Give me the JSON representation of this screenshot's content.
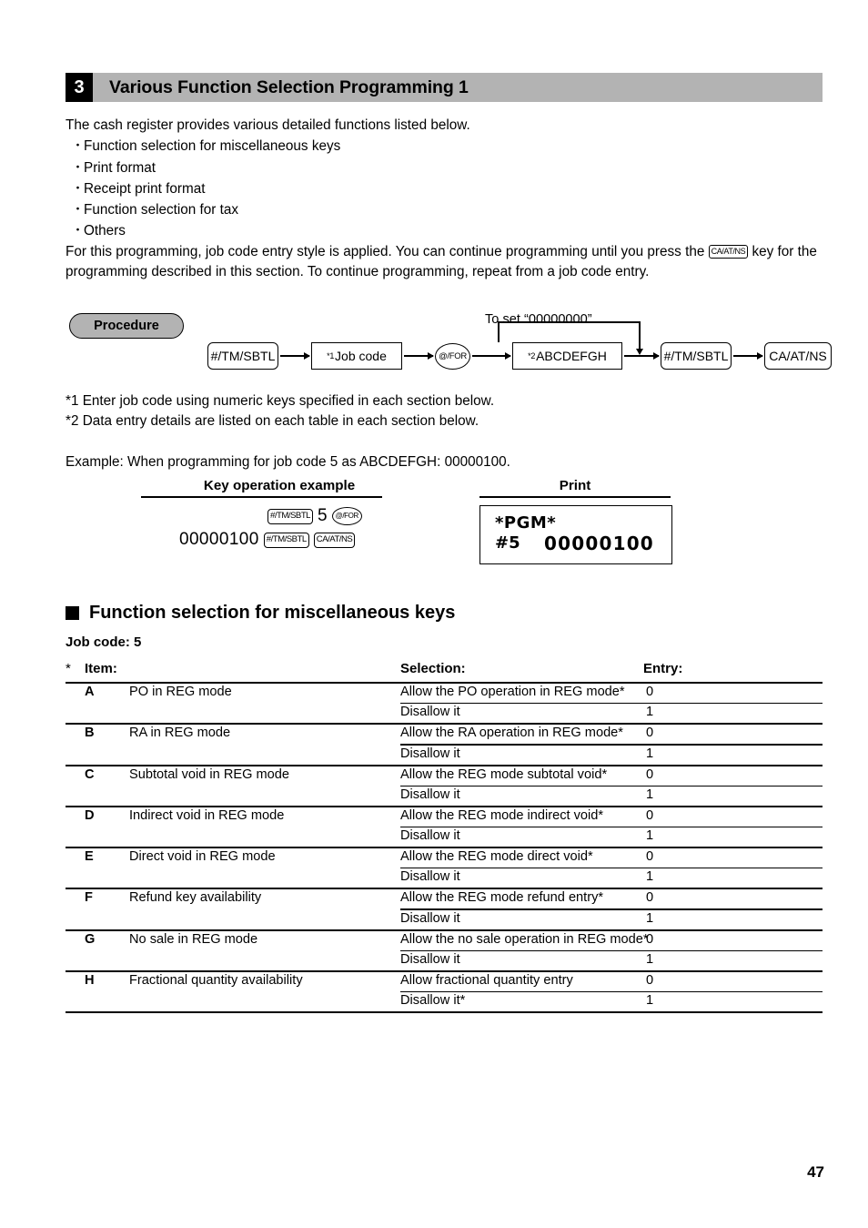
{
  "section": {
    "number": "3",
    "title": "Various Function Selection Programming 1"
  },
  "intro": {
    "lead": "The cash register provides various detailed functions listed below.",
    "bullets": [
      "Function selection for miscellaneous keys",
      "Print format",
      "Receipt print format",
      "Function selection for tax",
      "Others"
    ],
    "para_before_key": "For this programming, job code entry style is applied.  You can continue programming until you press the",
    "inline_key": "CA/AT/NS",
    "para_after_key": "key for the programming described in this section.  To continue programming, repeat from a job code entry."
  },
  "procedure": {
    "badge": "Procedure",
    "to_set_label": "To set “00000000”",
    "steps": [
      {
        "type": "key",
        "label": "#/TM/SBTL"
      },
      {
        "type": "box",
        "sup": "*1",
        "label": "Job code"
      },
      {
        "type": "circle",
        "label": "@/FOR"
      },
      {
        "type": "box",
        "sup": "*2",
        "label": "ABCDEFGH"
      },
      {
        "type": "key",
        "label": "#/TM/SBTL"
      },
      {
        "type": "key",
        "label": "CA/AT/NS"
      }
    ]
  },
  "notes": {
    "note1": "*1  Enter job code using numeric keys specified in each section below.",
    "note2": "*2  Data entry details are listed on each table in each section below.",
    "example": "Example:  When programming for job code 5 as ABCDEFGH: 00000100."
  },
  "example_block": {
    "key_operation_title": "Key operation example",
    "print_title": "Print",
    "key_row1": [
      {
        "type": "key",
        "label": "#/TM/SBTL"
      },
      {
        "type": "text",
        "label": "5"
      },
      {
        "type": "circle",
        "label": "@/FOR"
      }
    ],
    "key_row2": [
      {
        "type": "amount",
        "label": "00000100"
      },
      {
        "type": "key",
        "label": "#/TM/SBTL"
      },
      {
        "type": "key",
        "label": "CA/AT/NS"
      }
    ],
    "print_line1": "*PGM*",
    "print_line2_label": "#5",
    "print_line2_value": "00000100"
  },
  "function_selection": {
    "heading": "Function selection for miscellaneous keys",
    "job_code": "Job code:  5",
    "columns": {
      "star": "*",
      "item": "Item:",
      "selection": "Selection:",
      "entry": "Entry:"
    },
    "rows": [
      {
        "letter": "A",
        "item": "PO in REG mode",
        "options": [
          {
            "selection": "Allow the PO operation in REG mode*",
            "entry": "0"
          },
          {
            "selection": "Disallow it",
            "entry": "1"
          }
        ]
      },
      {
        "letter": "B",
        "item": "RA in REG mode",
        "options": [
          {
            "selection": "Allow the RA operation in REG mode*",
            "entry": "0"
          },
          {
            "selection": "Disallow it",
            "entry": "1"
          }
        ]
      },
      {
        "letter": "C",
        "item": "Subtotal void in REG mode",
        "options": [
          {
            "selection": "Allow the REG mode subtotal void*",
            "entry": "0"
          },
          {
            "selection": "Disallow it",
            "entry": "1"
          }
        ]
      },
      {
        "letter": "D",
        "item": "Indirect void in REG mode",
        "options": [
          {
            "selection": "Allow the REG mode indirect void*",
            "entry": "0"
          },
          {
            "selection": "Disallow it",
            "entry": "1"
          }
        ]
      },
      {
        "letter": "E",
        "item": "Direct void in REG mode",
        "options": [
          {
            "selection": "Allow the REG mode direct void*",
            "entry": "0"
          },
          {
            "selection": "Disallow it",
            "entry": "1"
          }
        ]
      },
      {
        "letter": "F",
        "item": "Refund key availability",
        "options": [
          {
            "selection": "Allow the REG mode refund entry*",
            "entry": "0"
          },
          {
            "selection": "Disallow it",
            "entry": "1"
          }
        ]
      },
      {
        "letter": "G",
        "item": "No sale in REG mode",
        "options": [
          {
            "selection": "Allow the no sale operation in REG mode*",
            "entry": "0"
          },
          {
            "selection": "Disallow it",
            "entry": "1"
          }
        ]
      },
      {
        "letter": "H",
        "item": "Fractional quantity availability",
        "options": [
          {
            "selection": "Allow fractional quantity entry",
            "entry": "0"
          },
          {
            "selection": "Disallow it*",
            "entry": "1"
          }
        ]
      }
    ]
  },
  "footer": {
    "page_number": "47"
  },
  "colors": {
    "header_bar": "#b3b3b3",
    "header_num_bg": "#000000",
    "badge_bg": "#b3b3b3"
  }
}
